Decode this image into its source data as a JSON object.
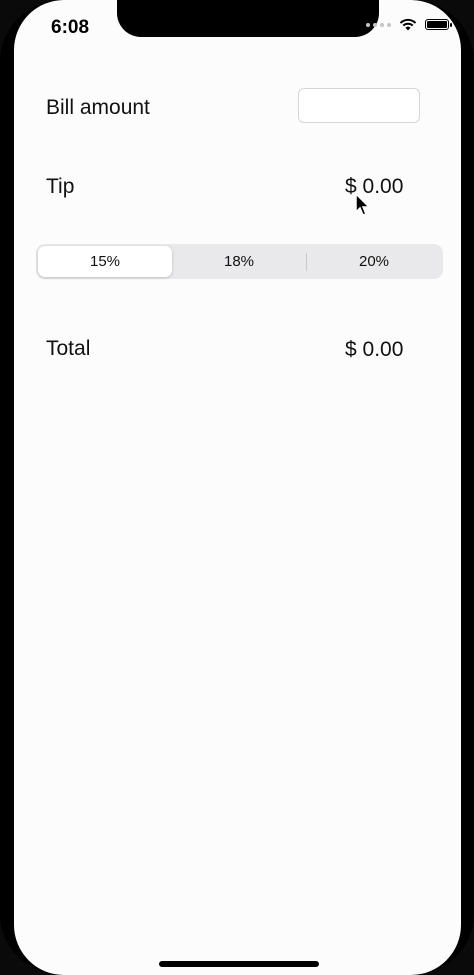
{
  "status_bar": {
    "time": "6:08"
  },
  "bill": {
    "label": "Bill amount",
    "input_value": ""
  },
  "tip": {
    "label": "Tip",
    "value": "$ 0.00"
  },
  "tip_selector": {
    "options": [
      "15%",
      "18%",
      "20%"
    ],
    "selected": "15%"
  },
  "total": {
    "label": "Total",
    "value": "$ 0.00"
  },
  "colors": {
    "background": "#fdfcfd",
    "segment_bg": "#e9e9eb",
    "text": "#111111"
  }
}
